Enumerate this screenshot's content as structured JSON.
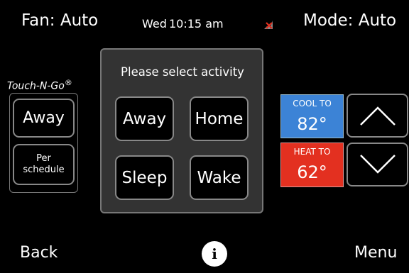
{
  "top_bar": {
    "fan": "Fan: Auto",
    "day": "Wed",
    "time": "10:15 am",
    "mode": "Mode: Auto"
  },
  "touch_n_go": {
    "logo_text": "Touch-N-Go",
    "logo_mark": "®",
    "away_label": "Away",
    "per_schedule_label": "Per schedule"
  },
  "activity_dialog": {
    "title": "Please select activity",
    "options": [
      "Away",
      "Home",
      "Sleep",
      "Wake"
    ]
  },
  "setpoints": {
    "cool_label": "COOL TO",
    "cool_value": "82°",
    "heat_label": "HEAT TO",
    "heat_value": "62°"
  },
  "bottom_bar": {
    "back_label": "Back",
    "info_label": "i",
    "menu_label": "Menu"
  },
  "colors": {
    "cool": "#3c83d6",
    "heat": "#e33020",
    "background": "#000000",
    "dialog": "#333333"
  },
  "icons": [
    "wifi-disconnected-icon",
    "arrow-up-icon",
    "arrow-down-icon",
    "info-icon"
  ]
}
